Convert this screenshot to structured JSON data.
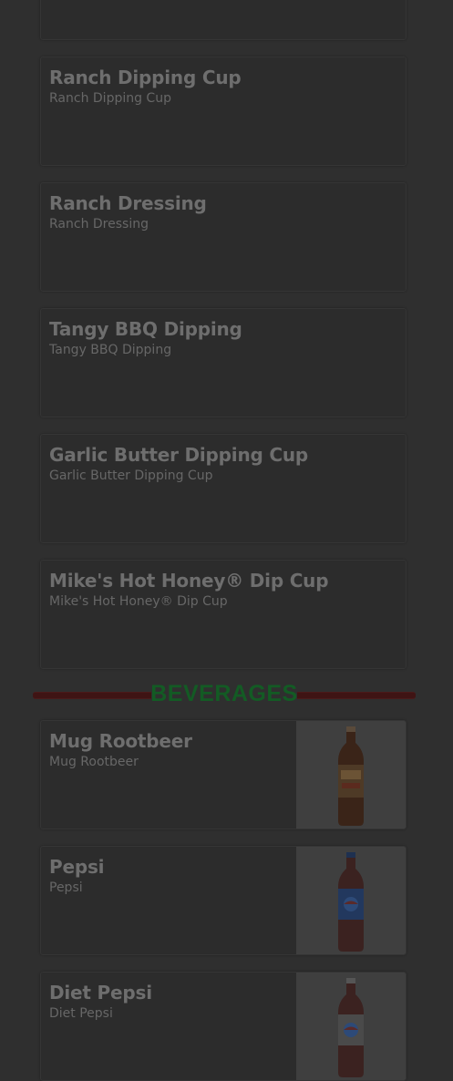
{
  "dips": [
    {
      "title": "Ranch Dipping Cup",
      "description": "Ranch Dipping Cup"
    },
    {
      "title": "Ranch Dressing",
      "description": "Ranch Dressing"
    },
    {
      "title": "Tangy BBQ Dipping",
      "description": "Tangy BBQ Dipping"
    },
    {
      "title": "Garlic Butter Dipping Cup",
      "description": "Garlic Butter Dipping Cup"
    },
    {
      "title": "Mike's Hot Honey® Dip Cup",
      "description": "Mike's Hot Honey® Dip Cup"
    }
  ],
  "beverages_section": {
    "heading": "BEVERAGES"
  },
  "beverages": [
    {
      "title": "Mug Rootbeer",
      "description": "Mug Rootbeer",
      "image": "mug-rootbeer-bottle"
    },
    {
      "title": "Pepsi",
      "description": "Pepsi",
      "image": "pepsi-bottle"
    },
    {
      "title": "Diet Pepsi",
      "description": "Diet Pepsi",
      "image": "diet-pepsi-bottle"
    }
  ],
  "colors": {
    "overlay_background": "#2f2f2f",
    "section_heading": "#135b24",
    "divider_line": "#3f1414"
  }
}
